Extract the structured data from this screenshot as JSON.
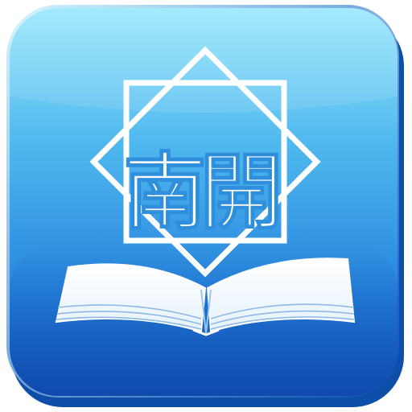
{
  "app_icon": {
    "name": "南開",
    "glyph_left": "南",
    "glyph_right": "開",
    "icon_semantics": [
      "octagram-emblem-icon",
      "open-book-icon"
    ],
    "colors": {
      "tile_top": "#8fe3fb",
      "tile_mid": "#3ea9ea",
      "tile_bottom": "#1463cf",
      "edge_shadow": "#0b4fb0",
      "emblem_stroke": "#ffffff",
      "glyph_fill": "#ffffff",
      "book_page": "#ffffff",
      "book_line": "#9cc6ec"
    }
  }
}
